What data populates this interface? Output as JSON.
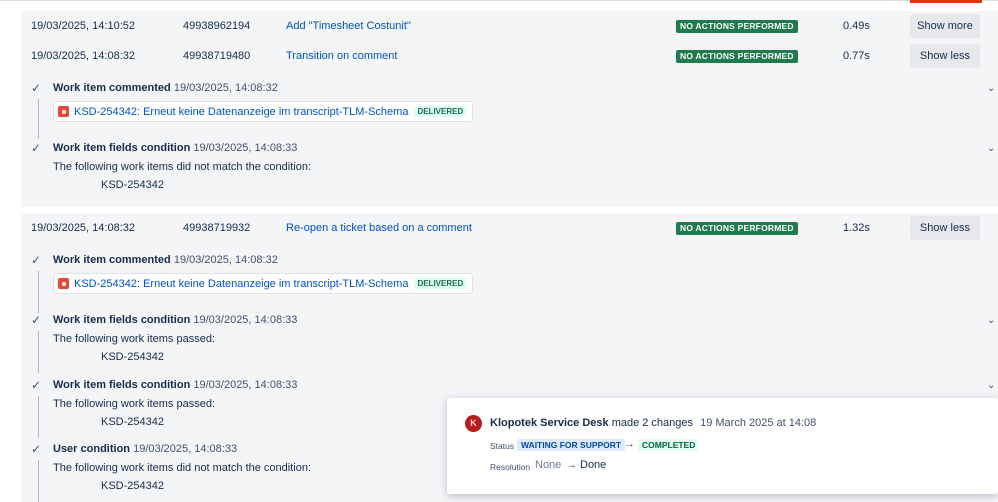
{
  "rows": [
    {
      "date": "19/03/2025, 14:10:52",
      "id": "49938962194",
      "rule": "Add \"Timesheet Costunit\"",
      "status": "NO ACTIONS PERFORMED",
      "duration": "0.49s",
      "button": "Show more"
    },
    {
      "date": "19/03/2025, 14:08:32",
      "id": "49938719480",
      "rule": "Transition on comment",
      "status": "NO ACTIONS PERFORMED",
      "duration": "0.77s",
      "button": "Show less"
    },
    {
      "date": "19/03/2025, 14:08:32",
      "id": "49938719932",
      "rule": "Re-open a ticket based on a comment",
      "status": "NO ACTIONS PERFORMED",
      "duration": "1.32s",
      "button": "Show less"
    }
  ],
  "block1": {
    "commented_title": "Work item commented",
    "commented_date": "19/03/2025, 14:08:32",
    "issue_text": "KSD-254342: Erneut keine Datenanzeige im transcript-TLM-Schema",
    "issue_status": "DELIVERED",
    "fields_title": "Work item fields condition",
    "fields_date": "19/03/2025, 14:08:33",
    "fields_desc": "The following work items did not match the condition:",
    "fields_key": "KSD-254342"
  },
  "block2": {
    "commented_title": "Work item commented",
    "commented_date": "19/03/2025, 14:08:32",
    "issue_text": "KSD-254342: Erneut keine Datenanzeige im transcript-TLM-Schema",
    "issue_status": "DELIVERED",
    "fields1_title": "Work item fields condition",
    "fields1_date": "19/03/2025, 14:08:33",
    "fields1_desc": "The following work items passed:",
    "fields1_key": "KSD-254342",
    "fields2_title": "Work item fields condition",
    "fields2_date": "19/03/2025, 14:08:33",
    "fields2_desc": "The following work items passed:",
    "fields2_key": "KSD-254342",
    "user_title": "User condition",
    "user_date": "19/03/2025, 14:08:33",
    "user_desc": "The following work items did not match the condition:",
    "user_key": "KSD-254342"
  },
  "popup": {
    "avatar_letter": "K",
    "author": "Klopotek Service Desk",
    "action": "made 2 changes",
    "date": "19 March 2025 at 14:08",
    "status_label": "Status",
    "status_from": "WAITING FOR SUPPORT",
    "status_to": "COMPLETED",
    "resolution_label": "Resolution",
    "resolution_from": "None",
    "resolution_to": "Done",
    "arrow": "→"
  },
  "icons": {
    "check": "check-icon",
    "chevron": "chevron-down-icon",
    "issue": "bug-icon"
  },
  "colors": {
    "lozenge": "#1f7a4d",
    "link": "#0052cc",
    "issue_icon": "#e5493a",
    "accent_bar": "#de350b"
  }
}
